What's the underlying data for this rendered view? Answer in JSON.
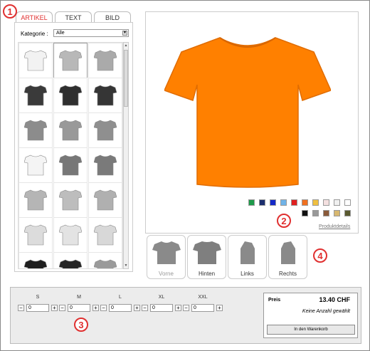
{
  "tabs": [
    {
      "label": "ARTIKEL"
    },
    {
      "label": "TEXT"
    },
    {
      "label": "BILD"
    }
  ],
  "markers": [
    "1",
    "2",
    "3",
    "4"
  ],
  "kategorie": {
    "label": "Kategorie :",
    "value": "Alle"
  },
  "product_grid": [
    {
      "icon": "white-tshirt-icon",
      "color": "#f2f2f2"
    },
    {
      "icon": "grey-tshirt-icon",
      "color": "#b8b8b8",
      "selected": true
    },
    {
      "icon": "grey-women-tshirt-icon",
      "color": "#aaaaaa"
    },
    {
      "icon": "black-tshirt-icon",
      "color": "#3a3a3a"
    },
    {
      "icon": "black-women-tshirt-icon",
      "color": "#2f2f2f"
    },
    {
      "icon": "black-longsleeve-icon",
      "color": "#353535"
    },
    {
      "icon": "grey-polo-icon",
      "color": "#8c8c8c"
    },
    {
      "icon": "grey-women-polo-icon",
      "color": "#999999"
    },
    {
      "icon": "grey-tanktop-icon",
      "color": "#8f8f8f"
    },
    {
      "icon": "white-women-tanktop-icon",
      "color": "#f4f4f4"
    },
    {
      "icon": "grey-sweatshirt-icon",
      "color": "#777777"
    },
    {
      "icon": "grey-hoodie-icon",
      "color": "#7a7a7a"
    },
    {
      "icon": "grey-shortsleeve-shirt-icon",
      "color": "#b5b5b5"
    },
    {
      "icon": "grey-women-shirt-icon",
      "color": "#bdbdbd"
    },
    {
      "icon": "grey-longsleeve-shirt-icon",
      "color": "#b0b0b0"
    },
    {
      "icon": "white-longsleeve-shirt-icon",
      "color": "#dcdcdc"
    },
    {
      "icon": "white-women-blouse-icon",
      "color": "#e3e3e3"
    },
    {
      "icon": "white-long-shirt-icon",
      "color": "#d8d8d8"
    },
    {
      "icon": "black-longsleeve-shirt-icon",
      "color": "#1e1e1e"
    },
    {
      "icon": "black-women-longsleeve-icon",
      "color": "#262626"
    },
    {
      "icon": "grey-folded-shirt-icon",
      "color": "#9a9a9a"
    }
  ],
  "preview": {
    "shirt_color": "#ff8000",
    "icon": "orange-tshirt-icon",
    "details_link": "Produktdetails",
    "swatches": [
      "#1e9a4a",
      "#1b2f6e",
      "#1428c8",
      "#6fb3e8",
      "#e02020",
      "#f07020",
      "#f0c040",
      "#f4e0e0",
      "#f0f0f0",
      "#ffffff",
      "#111111",
      "#999999",
      "#8a5a3a",
      "#d8b870",
      "#5a5a30"
    ]
  },
  "views": [
    {
      "label": "Vorne",
      "icon": "front-view-icon",
      "active": true
    },
    {
      "label": "Hinten",
      "icon": "back-view-icon"
    },
    {
      "label": "Links",
      "icon": "left-view-icon"
    },
    {
      "label": "Rechts",
      "icon": "right-view-icon"
    }
  ],
  "sizes": [
    {
      "name": "S",
      "qty": "0"
    },
    {
      "name": "M",
      "qty": "0"
    },
    {
      "name": "L",
      "qty": "0"
    },
    {
      "name": "XL",
      "qty": "0"
    },
    {
      "name": "XXL",
      "qty": "0"
    }
  ],
  "stepper": {
    "minus": "−",
    "plus": "+"
  },
  "price": {
    "label": "Preis",
    "value": "13.40 CHF",
    "note": "Keine Anzahl gewählt",
    "cart_button": "In den Warenkorb"
  }
}
